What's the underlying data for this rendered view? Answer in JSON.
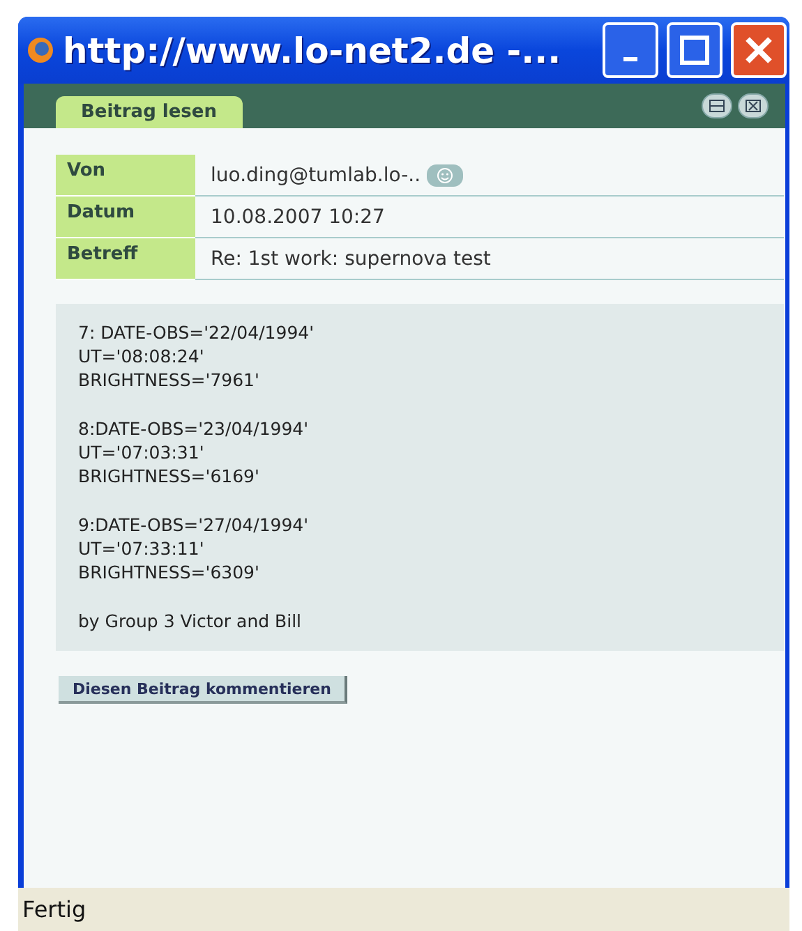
{
  "window": {
    "title": "http://www.lo-net2.de -..."
  },
  "tabs": [
    {
      "label": "Beitrag lesen",
      "selected": true
    }
  ],
  "fields": [
    {
      "label": "Von",
      "value": "luo.ding@tumlab.lo-..",
      "has_profile": true
    },
    {
      "label": "Datum",
      "value": "10.08.2007 10:27",
      "has_profile": false
    },
    {
      "label": "Betreff",
      "value": "Re: 1st work: supernova test",
      "has_profile": false
    }
  ],
  "message": [
    [
      "7: DATE-OBS='22/04/1994'",
      "UT='08:08:24'",
      "BRIGHTNESS='7961'"
    ],
    [
      "8:DATE-OBS='23/04/1994'",
      "UT='07:03:31'",
      "BRIGHTNESS='6169'"
    ],
    [
      "9:DATE-OBS='27/04/1994'",
      "UT='07:33:11'",
      "BRIGHTNESS='6309'"
    ],
    [
      "by Group 3 Victor and Bill"
    ]
  ],
  "comment_button": "Diesen Beitrag kommentieren",
  "status_bar": "Fertig"
}
